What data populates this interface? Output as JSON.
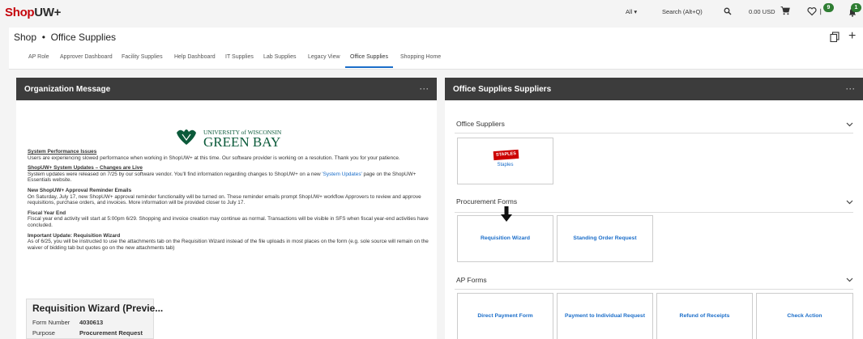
{
  "topbar": {
    "logo_prefix": "Shop",
    "logo_suffix": "UW+",
    "search_scope": "All ▾",
    "search_placeholder": "Search (Alt+Q)",
    "cart_total": "0.00 USD",
    "favorites_badge": "9",
    "notifications_badge": "1",
    "accent_color": "#c5050c",
    "badge_color": "#2e7d32"
  },
  "header": {
    "breadcrumb": "Shop  •  Office Supplies"
  },
  "tabs": [
    {
      "label": "AP Role"
    },
    {
      "label": "Approver Dashboard"
    },
    {
      "label": "Facility Supplies"
    },
    {
      "label": "Help Dashboard"
    },
    {
      "label": "IT Supplies"
    },
    {
      "label": "Lab Supplies"
    },
    {
      "label": "Legacy View"
    },
    {
      "label": "Office Supplies"
    },
    {
      "label": "Shopping Home"
    }
  ],
  "org_panel": {
    "title": "Organization Message",
    "dots": "···",
    "logo_line1": "UNIVERSITY of WISCONSIN",
    "logo_line2": "GREEN BAY",
    "messages": [
      {
        "title": "System Performance Issues",
        "body": "Users are experiencing slowed performance when working in ShopUW+ at this time. Our software provider is working on a resolution. Thank you for your patience."
      },
      {
        "title": "ShopUW+ System Updates – Changes are Live",
        "body_before": "System updates were released on 7/25 by our software vendor. You'll find information regarding changes to ShopUW+ on a new ",
        "link": "'System Updates'",
        "body_after": " page on the ShopUW+ Essentials website."
      },
      {
        "title": "New ShopUW+ Approval Reminder Emails",
        "body": "On Saturday, July 17, new ShopUW+ approval reminder functionality will be turned on.  These reminder emails prompt ShopUW+ workflow Approvers to review and approve requisitions, purchase orders, and invoices.  More information will be provided closer to July 17."
      },
      {
        "title": "Fiscal Year End",
        "body": "Fiscal year end activity will start at 5:00pm 6/29.  Shopping and invoice creation may continue as normal.  Transactions will be visible in SFS when fiscal year-end activities have concluded."
      },
      {
        "title": "Important Update: Requisition Wizard",
        "body": "As of 6/25, you will be instructed to use the attachments tab on the Requisition Wizard instead of the file uploads in most places on the form (e.g. sole source will remain on the waiver of bidding tab but quotes go on the new attachments tab)"
      }
    ]
  },
  "popup": {
    "title": "Requisition Wizard (Previe...",
    "form_number_label": "Form Number",
    "form_number": "4030613",
    "purpose_label": "Purpose",
    "purpose": "Procurement Request"
  },
  "suppliers_panel": {
    "title": "Office Supplies Suppliers",
    "dots": "···",
    "sections": {
      "office_suppliers": "Office Suppliers",
      "procurement_forms": "Procurement Forms",
      "ap_forms": "AP Forms"
    },
    "staples_logo": "STAPLES",
    "staples_label": "Staples",
    "procurement_tiles": [
      "Requisition Wizard",
      "Standing Order Request"
    ],
    "ap_tiles": [
      "Direct Payment Form",
      "Payment to Individual Request",
      "Refund of Receipts",
      "Check Action"
    ]
  }
}
